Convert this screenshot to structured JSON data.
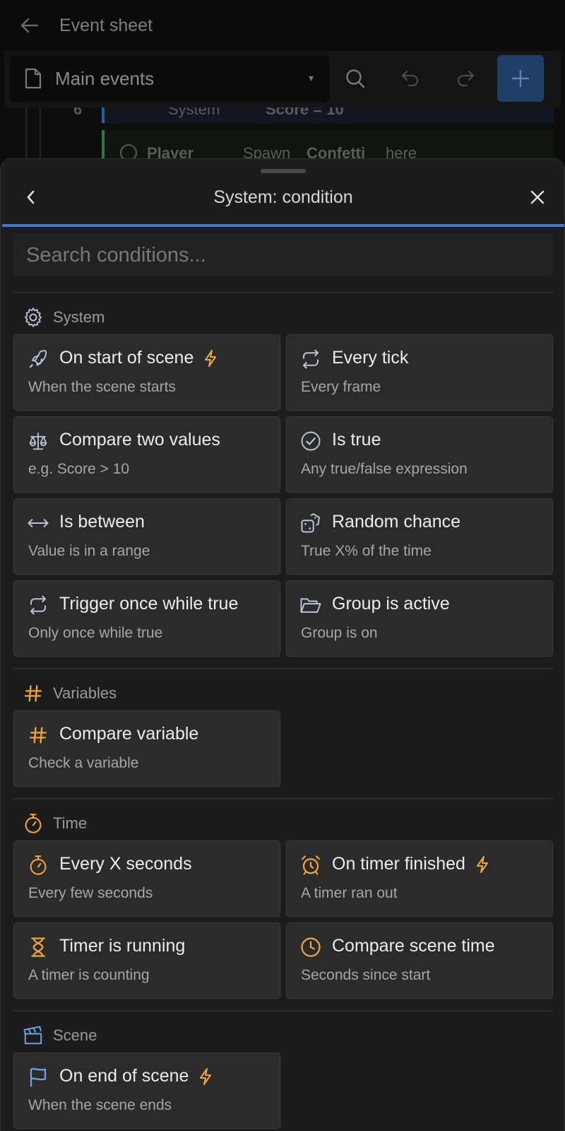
{
  "app_bar": {
    "title": "Event sheet"
  },
  "toolbar": {
    "sheet_name": "Main events",
    "caret": "▾"
  },
  "event_rows": {
    "number": "6",
    "row1": {
      "object": "System",
      "action": "Score = 10"
    },
    "row2": {
      "object": "Player",
      "action_prefix": "Spawn",
      "action_target": "Confetti",
      "action_suffix": "here"
    }
  },
  "sheet": {
    "title": "System: condition",
    "back_label": "‹",
    "search_placeholder": "Search conditions...",
    "accent_color": "#3b7ad9"
  },
  "sections": {
    "system": {
      "name": "System",
      "icon": "gear-icon",
      "items": [
        {
          "title": "On start of scene",
          "desc": "When the scene starts",
          "icon": "rocket-icon",
          "trigger": true
        },
        {
          "title": "Every tick",
          "desc": "Every frame",
          "icon": "repeat-icon",
          "trigger": false
        },
        {
          "title": "Compare two values",
          "desc": "e.g. Score > 10",
          "icon": "scale-icon",
          "trigger": false
        },
        {
          "title": "Is true",
          "desc": "Any true/false expression",
          "icon": "check-circle-icon",
          "trigger": false
        },
        {
          "title": "Is between",
          "desc": "Value is in a range",
          "icon": "arrows-horizontal-icon",
          "trigger": false
        },
        {
          "title": "Random chance",
          "desc": "True X% of the time",
          "icon": "dice-icon",
          "trigger": false
        },
        {
          "title": "Trigger once while true",
          "desc": "Only once while true",
          "icon": "repeat-icon",
          "trigger": false
        },
        {
          "title": "Group is active",
          "desc": "Group is on",
          "icon": "folder-open-icon",
          "trigger": false
        }
      ]
    },
    "variables": {
      "name": "Variables",
      "icon": "hash-icon",
      "items": [
        {
          "title": "Compare variable",
          "desc": "Check a variable",
          "icon": "hash-icon",
          "trigger": false
        }
      ]
    },
    "time": {
      "name": "Time",
      "icon": "stopwatch-icon",
      "items": [
        {
          "title": "Every X seconds",
          "desc": "Every few seconds",
          "icon": "stopwatch-icon",
          "trigger": false
        },
        {
          "title": "On timer finished",
          "desc": "A timer ran out",
          "icon": "alarm-clock-icon",
          "trigger": true
        },
        {
          "title": "Timer is running",
          "desc": "A timer is counting",
          "icon": "hourglass-icon",
          "trigger": false
        },
        {
          "title": "Compare scene time",
          "desc": "Seconds since start",
          "icon": "clock-icon",
          "trigger": false
        }
      ]
    },
    "scene": {
      "name": "Scene",
      "icon": "clapperboard-icon",
      "items": [
        {
          "title": "On end of scene",
          "desc": "When the scene ends",
          "icon": "flag-icon",
          "trigger": true
        }
      ]
    }
  },
  "colors": {
    "system_icon": "#b9c4d6",
    "variables_icon": "#f0a63a",
    "time_icon": "#f0a63a",
    "scene_icon": "#6f9fe6",
    "trigger_bolt": "#f0a63a"
  }
}
